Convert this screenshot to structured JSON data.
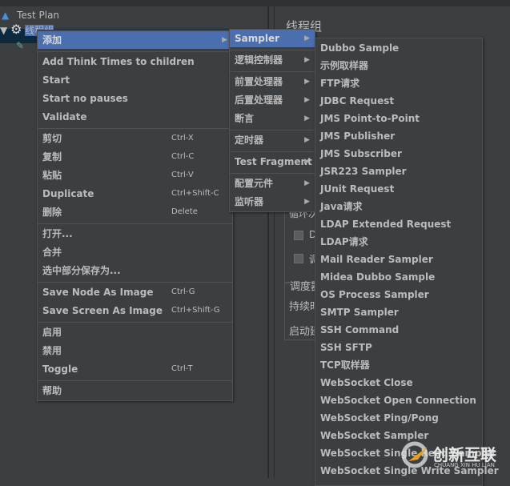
{
  "tree": {
    "test_plan": "Test Plan",
    "thread_group": "线程组"
  },
  "right_panel": {
    "title": "线程组",
    "loop_label": "循环次",
    "chk1_label": "D",
    "chk2_label": "调",
    "scheduler_label": "调度器",
    "duration_label": "持续时",
    "delay_label": "启动延"
  },
  "context_menu": {
    "items": [
      {
        "label": "添加",
        "submenu": true,
        "highlighted": true
      },
      {
        "sep": true
      },
      {
        "label": "Add Think Times to children"
      },
      {
        "label": "Start"
      },
      {
        "label": "Start no pauses"
      },
      {
        "label": "Validate"
      },
      {
        "sep": true
      },
      {
        "label": "剪切",
        "shortcut": "Ctrl-X"
      },
      {
        "label": "复制",
        "shortcut": "Ctrl-C"
      },
      {
        "label": "粘贴",
        "shortcut": "Ctrl-V"
      },
      {
        "label": "Duplicate",
        "shortcut": "Ctrl+Shift-C"
      },
      {
        "label": "删除",
        "shortcut": "Delete"
      },
      {
        "sep": true
      },
      {
        "label": "打开..."
      },
      {
        "label": "合并"
      },
      {
        "label": "选中部分保存为..."
      },
      {
        "sep": true
      },
      {
        "label": "Save Node As Image",
        "shortcut": "Ctrl-G"
      },
      {
        "label": "Save Screen As Image",
        "shortcut": "Ctrl+Shift-G"
      },
      {
        "sep": true
      },
      {
        "label": "启用"
      },
      {
        "label": "禁用"
      },
      {
        "label": "Toggle",
        "shortcut": "Ctrl-T"
      },
      {
        "sep": true
      },
      {
        "label": "帮助"
      }
    ]
  },
  "add_submenu": {
    "items": [
      {
        "label": "Sampler",
        "submenu": true,
        "highlighted": true
      },
      {
        "sep": true
      },
      {
        "label": "逻辑控制器",
        "submenu": true
      },
      {
        "sep": true
      },
      {
        "label": "前置处理器",
        "submenu": true
      },
      {
        "label": "后置处理器",
        "submenu": true
      },
      {
        "label": "断言",
        "submenu": true
      },
      {
        "sep": true
      },
      {
        "label": "定时器",
        "submenu": true
      },
      {
        "sep": true
      },
      {
        "label": "Test Fragment",
        "submenu": true
      },
      {
        "sep": true
      },
      {
        "label": "配置元件",
        "submenu": true
      },
      {
        "label": "监听器",
        "submenu": true
      }
    ]
  },
  "sampler_submenu": {
    "items": [
      {
        "label": "Dubbo Sample"
      },
      {
        "label": "示例取样器"
      },
      {
        "label": "FTP请求"
      },
      {
        "label": "JDBC Request"
      },
      {
        "label": "JMS Point-to-Point"
      },
      {
        "label": "JMS Publisher"
      },
      {
        "label": "JMS Subscriber"
      },
      {
        "label": "JSR223 Sampler"
      },
      {
        "label": "JUnit Request"
      },
      {
        "label": "Java请求"
      },
      {
        "label": "LDAP Extended Request"
      },
      {
        "label": "LDAP请求"
      },
      {
        "label": "Mail Reader Sampler"
      },
      {
        "label": "Midea Dubbo Sample"
      },
      {
        "label": "OS Process Sampler"
      },
      {
        "label": "SMTP Sampler"
      },
      {
        "label": "SSH Command"
      },
      {
        "label": "SSH SFTP"
      },
      {
        "label": "TCP取样器"
      },
      {
        "label": "WebSocket Close"
      },
      {
        "label": "WebSocket Open Connection"
      },
      {
        "label": "WebSocket Ping/Pong"
      },
      {
        "label": "WebSocket Sampler"
      },
      {
        "label": "WebSocket Single Read Sampler"
      },
      {
        "label": "WebSocket Single Write Sampler"
      }
    ]
  },
  "watermark": {
    "text": "创新互联",
    "subtext": "CHUANG XIN HU LIAN"
  },
  "colors": {
    "highlight": "#4b6eaf",
    "background": "#3c3f41",
    "selected_row": "#0d293e"
  }
}
